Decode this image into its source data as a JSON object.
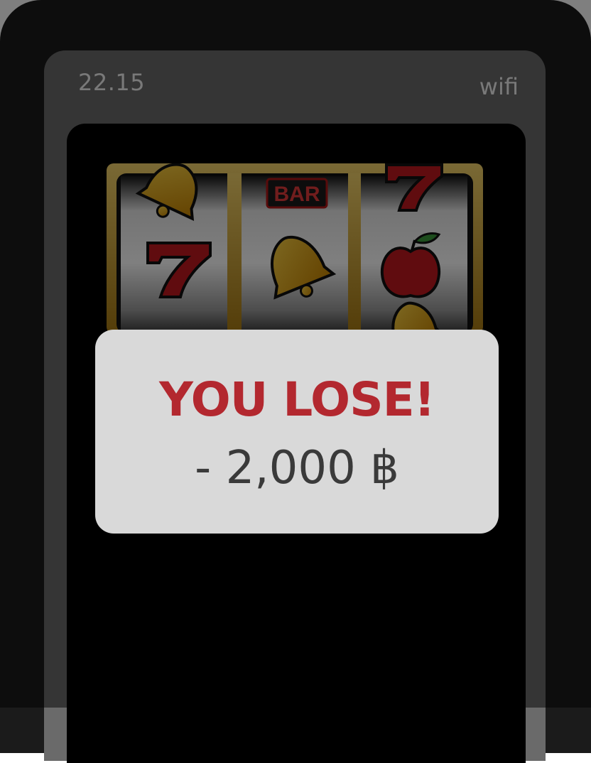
{
  "status_bar": {
    "time": "22.15",
    "network": "wifi"
  },
  "slot_reels": [
    {
      "top": "bell",
      "middle": "seven",
      "bottom": ""
    },
    {
      "top": "bar",
      "middle": "bell",
      "bottom": ""
    },
    {
      "top": "seven",
      "middle": "apple",
      "bottom": "bell"
    }
  ],
  "slot_labels": {
    "bar_symbol": "BAR"
  },
  "result": {
    "title": "YOU LOSE!",
    "amount": "- 2,000 ฿"
  },
  "colors": {
    "frame": "#1b1b1b",
    "screen": "#6a6a6a",
    "app_background": "#000000",
    "dialog": "#d9d9d9",
    "lose_text": "#b3282f"
  }
}
